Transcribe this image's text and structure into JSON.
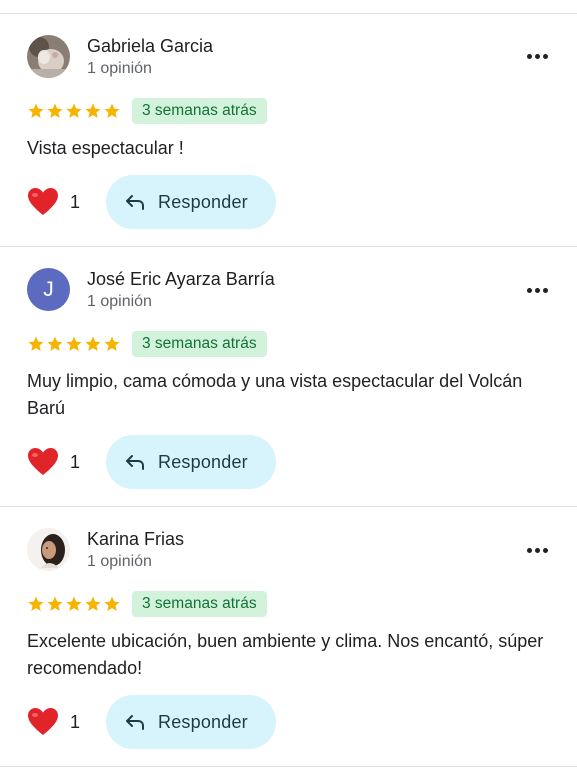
{
  "reviews": [
    {
      "author": "Gabriela Garcia",
      "review_count": "1 opinión",
      "avatar_type": "photo",
      "rating": 5,
      "time_ago": "3 semanas atrás",
      "text": "Vista espectacular !",
      "likes": "1",
      "reply_label": "Responder"
    },
    {
      "author": "José Eric Ayarza Barría",
      "review_count": "1 opinión",
      "avatar_type": "letter",
      "avatar_letter": "J",
      "rating": 5,
      "time_ago": "3 semanas atrás",
      "text": "Muy limpio, cama cómoda y una vista espectacular del Volcán Barú",
      "likes": "1",
      "reply_label": "Responder"
    },
    {
      "author": "Karina Frias",
      "review_count": "1 opinión",
      "avatar_type": "photo",
      "rating": 5,
      "time_ago": "3 semanas atrás",
      "text": "Excelente ubicación, buen ambiente y clima. Nos encantó, súper recomendado!",
      "likes": "1",
      "reply_label": "Responder"
    }
  ],
  "colors": {
    "star": "#f6b400",
    "badge_bg": "#d3f2dc",
    "badge_text": "#137333",
    "reply_bg": "#d7f3fc",
    "heart": "#e0242a",
    "letter_avatar": "#5c6bc0"
  },
  "icons": {
    "menu": "more-horizontal-icon",
    "heart": "heart-icon",
    "reply": "reply-arrow-icon",
    "star": "star-icon"
  }
}
